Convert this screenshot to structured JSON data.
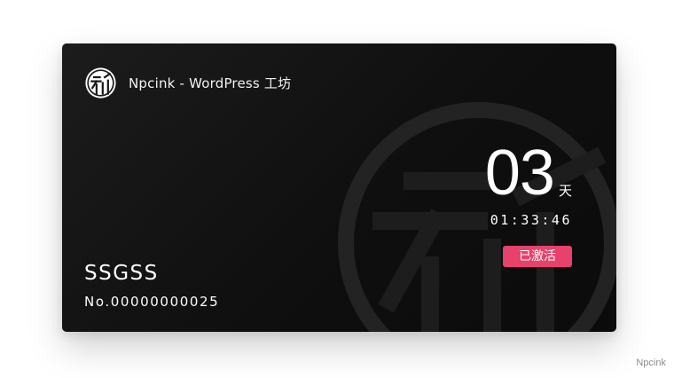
{
  "card": {
    "brand_name": "Npcink - WordPress 工坊",
    "logo_icon": "seal-logo-icon",
    "days_value": "03",
    "days_unit": "天",
    "time_remaining": "01:33:46",
    "status_label": "已激活",
    "holder_name": "SSGSS",
    "card_number": "No.00000000025"
  },
  "footer": {
    "credit": "Npcink"
  },
  "colors": {
    "card_background": "#111111",
    "status_badge": "#e8416b",
    "text": "#ffffff",
    "credit_text": "#8c8c8c"
  }
}
